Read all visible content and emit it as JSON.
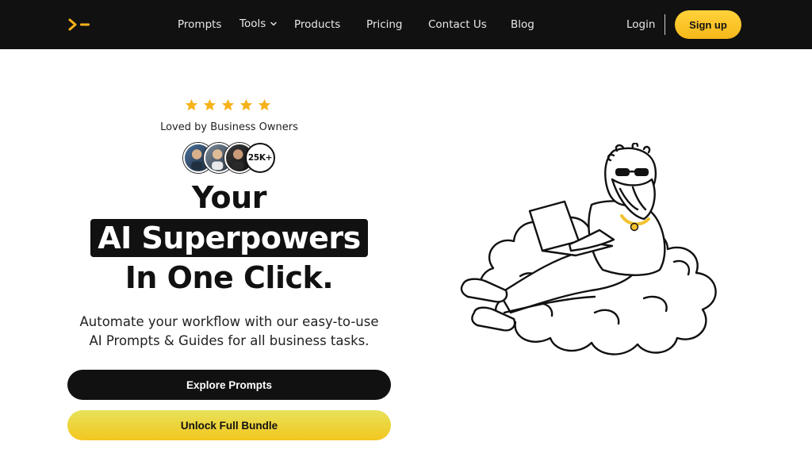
{
  "nav": {
    "links": [
      {
        "label": "Prompts"
      },
      {
        "label": "Tools"
      },
      {
        "label": "Products"
      },
      {
        "label": "Pricing"
      },
      {
        "label": "Contact Us"
      },
      {
        "label": "Blog"
      }
    ],
    "login": "Login",
    "signup": "Sign up"
  },
  "hero": {
    "rating_stars": 5,
    "loved": "Loved by Business Owners",
    "user_count": "25K+",
    "headline_1": "Your",
    "headline_2": "AI Superpowers",
    "headline_3": "In One Click.",
    "sub_1": "Automate your workflow with our easy-to-use",
    "sub_2": "AI Prompts & Guides for all business tasks.",
    "cta_primary": "Explore Prompts",
    "cta_secondary": "Unlock Full Bundle"
  },
  "colors": {
    "nav_bg": "#111111",
    "accent_yellow": "#f6b81a",
    "star": "#f5b21a",
    "text_dark": "#111111"
  }
}
